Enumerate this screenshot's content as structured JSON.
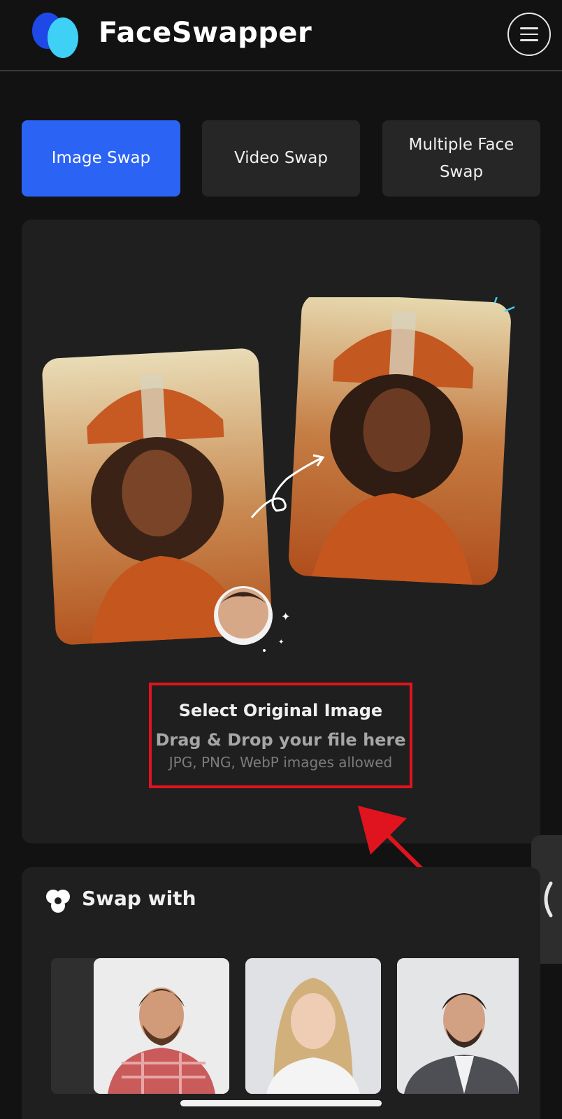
{
  "header": {
    "brand": "FaceSwapper",
    "menu_icon": "hamburger-menu-icon",
    "logo_colors": [
      "#1f49e6",
      "#3fd0f5"
    ]
  },
  "tabs": [
    {
      "label": "Image Swap",
      "active": true
    },
    {
      "label": "Video Swap",
      "active": false
    },
    {
      "label": "Multiple Face Swap",
      "active": false
    }
  ],
  "upload": {
    "title": "Select Original Image",
    "subtitle": "Drag & Drop your file here",
    "formats": "JPG, PNG, WebP images allowed",
    "highlight_color": "#e0141e"
  },
  "swap_with": {
    "title": "Swap with",
    "icon": "faces-cluster-icon",
    "thumbnails": [
      "man-plaid-shirt",
      "blonde-woman",
      "man-suit"
    ]
  },
  "colors": {
    "accent": "#2b63f5",
    "annotation_arrow": "#e0141e"
  }
}
